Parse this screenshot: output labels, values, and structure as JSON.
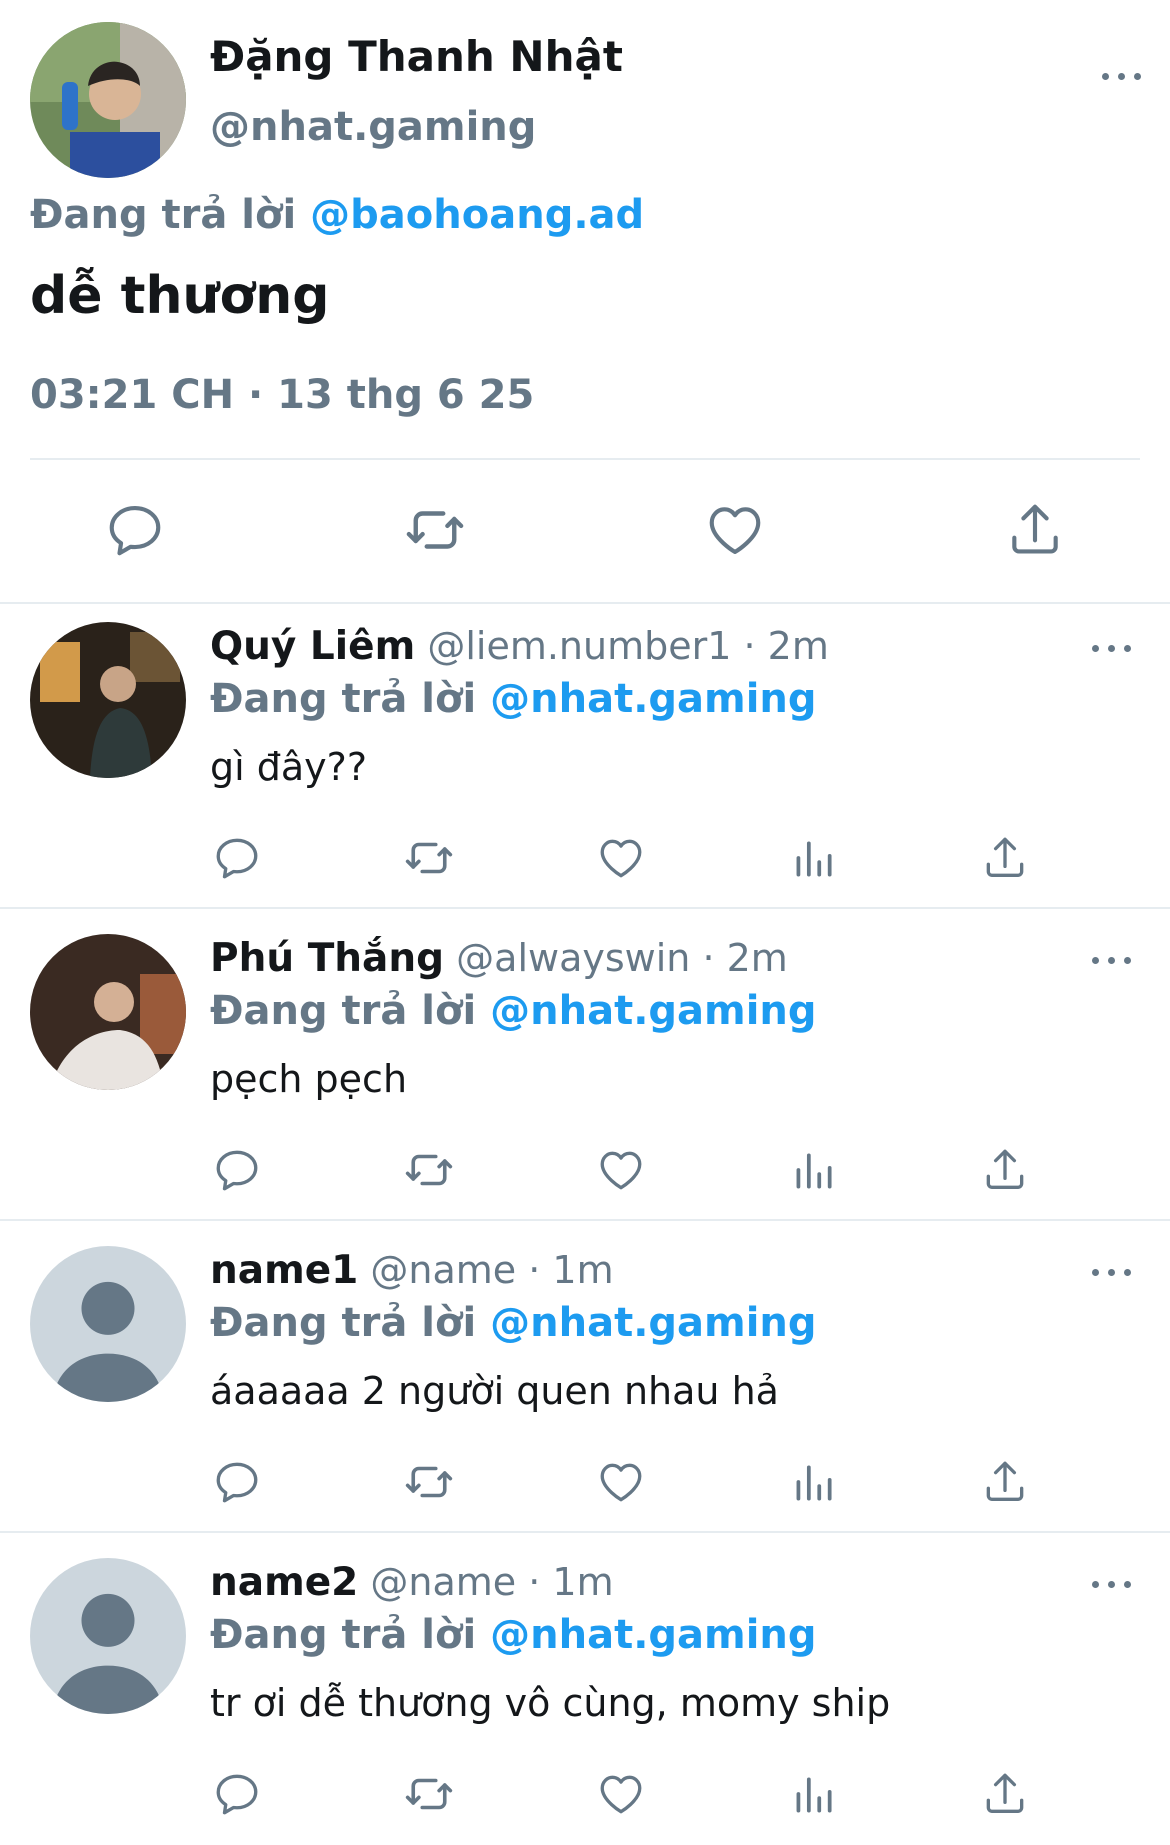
{
  "main_tweet": {
    "display_name": "Đặng Thanh Nhật",
    "handle": "@nhat.gaming",
    "replying_prefix": "Đang trả lời",
    "replying_to": "@baohoang.ad",
    "text": "dễ thương",
    "timestamp": "03:21 CH · 13 thg 6 25",
    "actions": [
      "reply-icon",
      "retweet-icon",
      "like-icon",
      "share-icon"
    ]
  },
  "replies": [
    {
      "display_name": "Quý Liêm",
      "handle": "@liem.number1",
      "time": "· 2m",
      "replying_prefix": "Đang trả lời",
      "replying_to": "@nhat.gaming",
      "text": "gì đây??"
    },
    {
      "display_name": "Phú Thắng",
      "handle": "@alwayswin",
      "time": "· 2m",
      "replying_prefix": "Đang trả lời",
      "replying_to": "@nhat.gaming",
      "text": "pẹch pẹch"
    },
    {
      "display_name": "name1",
      "handle": "@name",
      "time": "· 1m",
      "replying_prefix": "Đang trả lời",
      "replying_to": "@nhat.gaming",
      "text": "áaaaaa 2 người quen nhau hả"
    },
    {
      "display_name": "name2",
      "handle": "@name",
      "time": "· 1m",
      "replying_prefix": "Đang trả lời",
      "replying_to": "@nhat.gaming",
      "text": "tr ơi dễ thương vô cùng, momy ship"
    }
  ],
  "colors": {
    "accent": "#1d9bf0",
    "secondary_text": "#657786",
    "primary_text": "#14171a",
    "divider": "#e6ecf0"
  }
}
